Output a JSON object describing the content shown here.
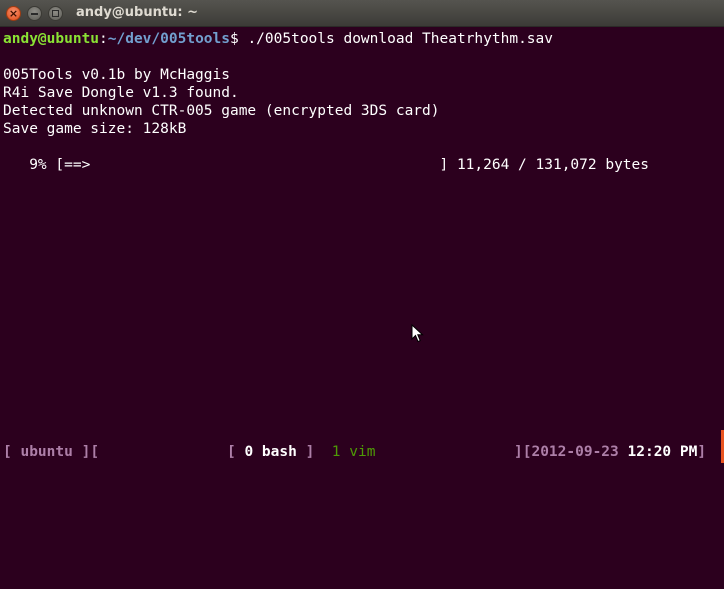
{
  "window": {
    "title": "andy@ubuntu: ~",
    "buttons": {
      "close": "×",
      "minimize": "",
      "maximize": ""
    }
  },
  "terminal": {
    "prompt": {
      "user_host": "andy@ubuntu",
      "separator": ":",
      "path": "~/dev/005tools",
      "symbol": "$",
      "command": " ./005tools download Theatrhythm.sav"
    },
    "output": [
      "005Tools v0.1b by McHaggis",
      "R4i Save Dongle v1.3 found.",
      "Detected unknown CTR-005 game (encrypted 3DS card)",
      "Save game size: 128kB"
    ],
    "progress": {
      "percent_label": "   9% [==>                                        ] 11,264 / 131,072 bytes",
      "fraction": 0.0859
    }
  },
  "statusbar": {
    "host_open": "[ ",
    "host": "ubuntu",
    "host_close": " ][",
    "win_open": "[ ",
    "win_active": "0 bash",
    "win_close": " ]",
    "win_other": "1 vim",
    "right_open": "][",
    "date": "2012-09-23",
    "time": "12:20 PM",
    "right_close": "]"
  },
  "colors": {
    "background": "#2c001e",
    "user_host": "#8ae234",
    "path": "#729fcf",
    "status_bracket": "#ad7fa8",
    "status_inactive_window": "#4e9a06"
  }
}
